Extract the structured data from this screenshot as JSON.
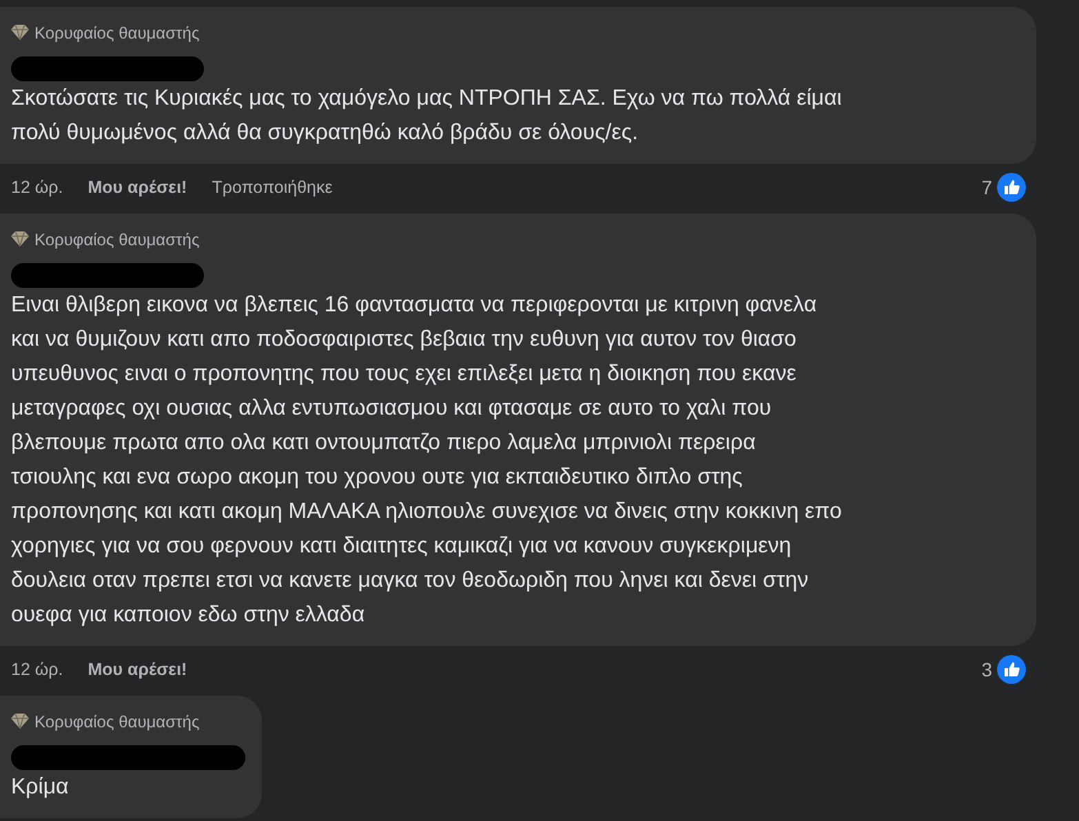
{
  "comments": [
    {
      "badge": "Κορυφαίος θαυμαστής",
      "lines": [
        "Σκοτώσατε τις Κυριακές μας το χαμόγελο μας ΝΤΡΟΠΗ ΣΑΣ. Εχω να πω πολλά είμαι",
        "πολύ θυμωμένος αλλά θα συγκρατηθώ καλό βράδυ σε όλους/ες."
      ],
      "time": "12 ώρ.",
      "like": "Μου αρέσει!",
      "edited": "Τροποποιήθηκε",
      "reactions": "7"
    },
    {
      "badge": "Κορυφαίος θαυμαστής",
      "lines": [
        "Ειναι θλιβερη εικονα να βλεπεις 16 φαντασματα να περιφερονται με κιτρινη φανελα",
        "και να θυμιζουν κατι απο ποδοσφαιριστες βεβαια την ευθυνη για αυτον τον θιασο",
        "υπευθυνος ειναι ο προπονητης που τους εχει επιλεξει μετα η διοικηση που εκανε",
        "μεταγραφες οχι ουσιας αλλα εντυπωσιασμου και φτασαμε σε αυτο το χαλι που",
        "βλεπουμε πρωτα απο ολα κατι οντουμπατζο πιερο λαμελα μπρινιολι περειρα",
        "τσιουλης και ενα σωρο ακομη του χρονου ουτε για εκπαιδευτικο διπλο στης",
        "προπονησης και κατι ακομη ΜΑΛΑΚΑ ηλιοπουλε συνεχισε να δινεις στην κοκκινη επο",
        "χορηγιες για να σου φερνουν κατι διαιτητες καμικαζι για να κανουν συγκεκριμενη",
        "δουλεια οταν πρεπει ετσι να κανετε μαγκα τον θεοδωριδη που ληνει και δενει στην",
        "ουεφα για καποιον εδω στην ελλαδα"
      ],
      "time": "12 ώρ.",
      "like": "Μου αρέσει!",
      "reactions": "3"
    },
    {
      "badge": "Κορυφαίος θαυμαστής",
      "lines": [
        "Κρίμα"
      ]
    }
  ]
}
